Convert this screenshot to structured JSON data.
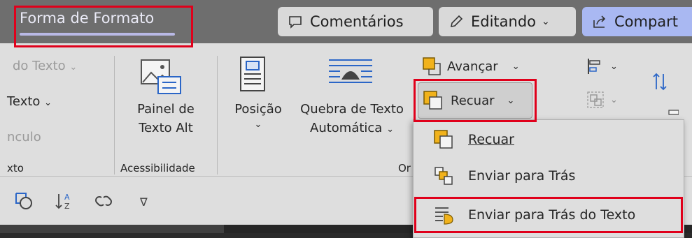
{
  "header": {
    "active_tab": "Forma de Formato",
    "comments_label": "Comentários",
    "editing_label": "Editando",
    "share_label": "Compart"
  },
  "ribbon": {
    "text_group": {
      "item1": "do Texto",
      "item2": "Texto",
      "item3": "nculo",
      "group_label": "xto"
    },
    "accessibility": {
      "alt_text_line1": "Painel de",
      "alt_text_line2": "Texto Alt",
      "group_label": "Acessibilidade"
    },
    "arrange": {
      "position_label": "Posição",
      "wrap_line1": "Quebra de Texto",
      "wrap_line2": "Automática",
      "bring_forward": "Avançar",
      "send_backward": "Recuar",
      "group_label_partial": "Or"
    }
  },
  "menu": {
    "items": [
      {
        "label": "Recuar",
        "icon": "send-backward-icon"
      },
      {
        "label": "Enviar para Trás",
        "icon": "send-to-back-icon"
      },
      {
        "label": "Enviar para Trás do Texto",
        "icon": "behind-text-icon"
      }
    ]
  },
  "colors": {
    "highlight_red": "#e0001b",
    "share_blue": "#a9b8f2",
    "icon_orange": "#f1b21b",
    "icon_blue": "#2b66c7"
  }
}
